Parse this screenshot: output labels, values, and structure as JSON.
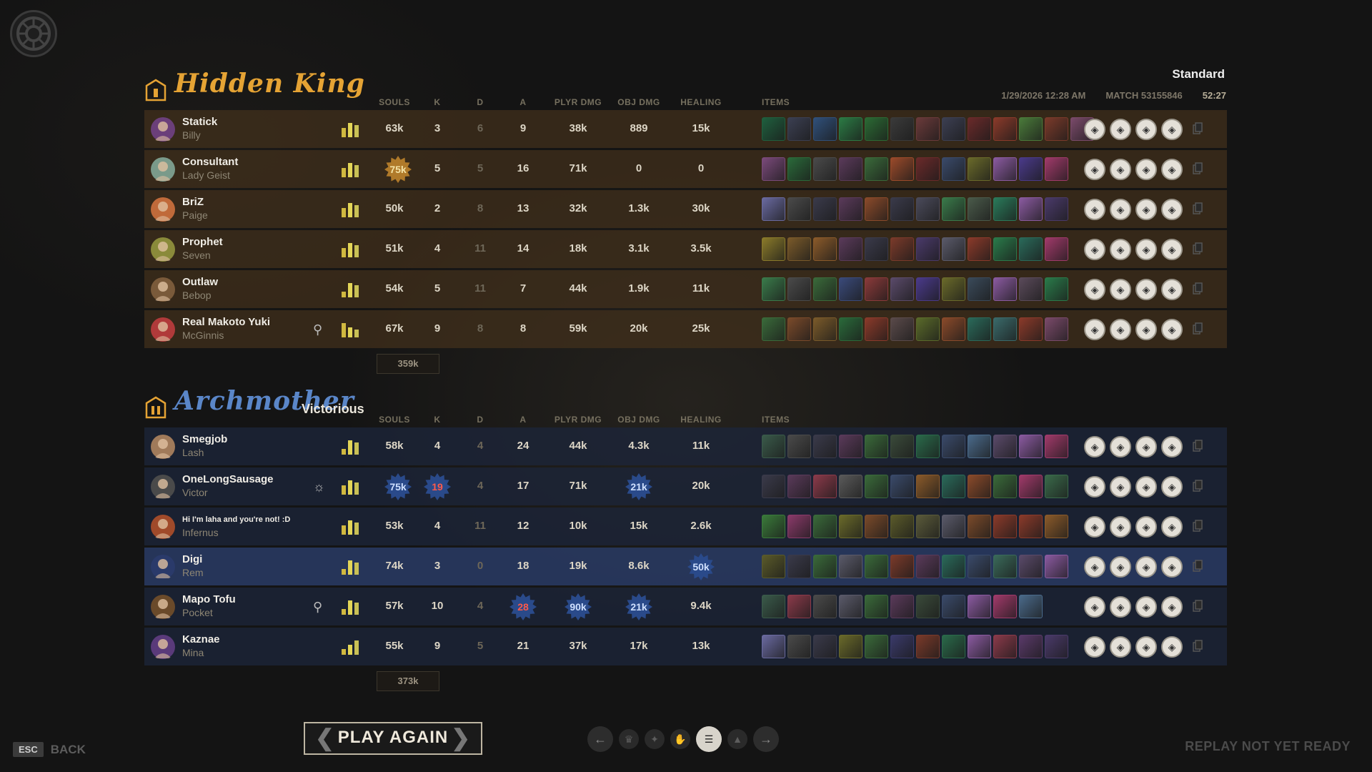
{
  "window": {
    "mode": "Standard"
  },
  "match_meta": {
    "date": "1/29/2026 12:28 AM",
    "match_id": "MATCH 53155846",
    "duration": "52:27"
  },
  "columns": {
    "souls": "SOULS",
    "k": "K",
    "d": "D",
    "a": "A",
    "player_damage": "PLYR DMG",
    "objective_damage": "OBJ DMG",
    "healing": "HEALING",
    "items": "ITEMS"
  },
  "team1": {
    "name": "Hidden King",
    "badge": "I",
    "result": "",
    "color": "#e5a334",
    "souls_total": "359k",
    "players": [
      {
        "name": "Statick",
        "hero": "Billy",
        "souls": "63k",
        "k": "3",
        "d": "6",
        "a": "9",
        "player_damage": "38k",
        "objective_damage": "889",
        "healing": "15k",
        "bars": [
          0.55,
          0.85,
          0.7
        ],
        "status_icon": "",
        "avatar_color": "#6b3f7a",
        "items": [
          "#1f5f3e",
          "#3b3f52",
          "#30507a",
          "#2b7a44",
          "#2b6a34",
          "#3a3a3a",
          "#6a3a3a",
          "#3c3f52",
          "#6a2a2a",
          "#8a3a2a",
          "#4a7a3a",
          "#7a3a2a",
          "#7a4a6a"
        ],
        "abilities": [
          "quill-icon",
          "wolf-icon",
          "shield-icon",
          "swirl-icon"
        ]
      },
      {
        "name": "Consultant",
        "hero": "Lady Geist",
        "souls": "75k",
        "souls_highlight": "gold",
        "k": "5",
        "d": "5",
        "a": "16",
        "player_damage": "71k",
        "objective_damage": "0",
        "healing": "0",
        "bars": [
          0.55,
          0.85,
          0.7
        ],
        "status_icon": "",
        "avatar_color": "#7a9a8a",
        "items": [
          "#7a4a7a",
          "#2a6a3a",
          "#4a4a4a",
          "#5a3a5a",
          "#3a6a3a",
          "#9a4a2a",
          "#6a2a2a",
          "#3a4a6a",
          "#6a6a2a",
          "#8a5aa0",
          "#4a3a8a",
          "#a03a6a"
        ],
        "abilities": [
          "bottle-icon",
          "wolf-icon",
          "leaf-icon",
          "hand-icon"
        ]
      },
      {
        "name": "BriZ",
        "hero": "Paige",
        "souls": "50k",
        "k": "2",
        "d": "8",
        "a": "13",
        "player_damage": "32k",
        "objective_damage": "1.3k",
        "healing": "30k",
        "bars": [
          0.55,
          0.85,
          0.7
        ],
        "status_icon": "",
        "avatar_color": "#c06a3a",
        "items": [
          "#6a6aa0",
          "#4a4a4a",
          "#3a3a4a",
          "#5a3a5a",
          "#8a4a2a",
          "#3a3a4a",
          "#4a4a5a",
          "#3a7a4a",
          "#4a5a4a",
          "#2a7a5a",
          "#8a5aa0",
          "#4a3a6a"
        ],
        "abilities": [
          "face-icon",
          "helm-icon",
          "tower-icon",
          "arrow-icon"
        ]
      },
      {
        "name": "Prophet",
        "hero": "Seven",
        "souls": "51k",
        "k": "4",
        "d": "11",
        "a": "14",
        "player_damage": "18k",
        "objective_damage": "3.1k",
        "healing": "3.5k",
        "bars": [
          0.55,
          0.85,
          0.7
        ],
        "status_icon": "",
        "avatar_color": "#8a8a3a",
        "items": [
          "#8a7a2a",
          "#7a5a2a",
          "#8a5a2a",
          "#5a3a5a",
          "#3a3a4a",
          "#7a3a2a",
          "#4a3a6a",
          "#5a5a6a",
          "#8a3a2a",
          "#2a7a4a",
          "#2a6a5a",
          "#a03a6a"
        ],
        "abilities": [
          "eye-icon",
          "spark-icon",
          "bolt-icon",
          "storm-icon"
        ]
      },
      {
        "name": "Outlaw",
        "hero": "Bebop",
        "souls": "54k",
        "k": "5",
        "d": "11",
        "a": "7",
        "player_damage": "44k",
        "objective_damage": "1.9k",
        "healing": "11k",
        "bars": [
          0.35,
          0.85,
          0.7
        ],
        "status_icon": "",
        "avatar_color": "#7a5a3a",
        "items": [
          "#3a7a4a",
          "#4a4a4a",
          "#3a6a3a",
          "#3a4a7a",
          "#8a3a3a",
          "#5a4a6a",
          "#4a3a8a",
          "#6a6a2a",
          "#3a4a5a",
          "#8a5aa0",
          "#5a4a5a",
          "#2a7a4a"
        ],
        "abilities": [
          "fist-icon",
          "gear-icon",
          "hook-icon",
          "bomb-icon"
        ]
      },
      {
        "name": "Real Makoto Yuki",
        "hero": "McGinnis",
        "souls": "67k",
        "k": "9",
        "d": "8",
        "a": "8",
        "player_damage": "59k",
        "objective_damage": "20k",
        "healing": "25k",
        "bars": [
          0.85,
          0.6,
          0.45
        ],
        "status_icon": "keyhole-icon",
        "avatar_color": "#b03a3a",
        "items": [
          "#3a6a3a",
          "#7a4a2a",
          "#7a5a2a",
          "#2a6a3a",
          "#8a3a2a",
          "#5a4a4a",
          "#5a6a2a",
          "#8a4a2a",
          "#2a6a5a",
          "#3a6a6a",
          "#8a3a2a",
          "#7a4a6a"
        ],
        "abilities": [
          "turret-icon",
          "wrench-icon",
          "wall-icon",
          "slash-icon"
        ]
      }
    ]
  },
  "team2": {
    "name": "Archmother",
    "badge": "II",
    "result": "Victorious",
    "color": "#5a86c8",
    "souls_total": "373k",
    "players": [
      {
        "name": "Smegjob",
        "hero": "Lash",
        "souls": "58k",
        "k": "4",
        "d": "4",
        "a": "24",
        "player_damage": "44k",
        "objective_damage": "4.3k",
        "healing": "11k",
        "bars": [
          0.35,
          0.85,
          0.7
        ],
        "status_icon": "",
        "avatar_color": "#a07a5a",
        "items": [
          "#3a5a4a",
          "#4a4a4a",
          "#3a3a4a",
          "#5a3a5a",
          "#3a6a3a",
          "#3a4a3a",
          "#2a6a4a",
          "#3a4a6a",
          "#4a6a8a",
          "#5a4a6a",
          "#8a5aa0",
          "#a03a6a"
        ],
        "abilities": [
          "whip-icon",
          "leap-icon",
          "ground-icon",
          "grab-icon"
        ]
      },
      {
        "name": "OneLongSausage",
        "hero": "Victor",
        "souls": "75k",
        "souls_highlight": "blue",
        "k": "19",
        "k_highlight": "red",
        "d": "4",
        "a": "17",
        "player_damage": "71k",
        "objective_damage": "21k",
        "objective_damage_highlight": "blue",
        "healing": "20k",
        "bars": [
          0.55,
          0.85,
          0.7
        ],
        "status_icon": "sun-icon",
        "avatar_color": "#4a4a4a",
        "items": [
          "#3a3a4a",
          "#5a3a5a",
          "#8a3a4a",
          "#5a5a5a",
          "#3a6a3a",
          "#3a4a6a",
          "#8a5a2a",
          "#2a6a5a",
          "#8a4a2a",
          "#3a6a3a",
          "#a03a6a",
          "#3a6a4a"
        ],
        "abilities": [
          "syringe-icon",
          "claw-icon",
          "pulse-icon",
          "heart-icon"
        ]
      },
      {
        "name": "Hi I'm laha and you're not! :D",
        "hero": "Infernus",
        "name_small": true,
        "souls": "53k",
        "k": "4",
        "d": "11",
        "a": "12",
        "player_damage": "10k",
        "objective_damage": "15k",
        "healing": "2.6k",
        "bars": [
          0.55,
          0.85,
          0.7
        ],
        "status_icon": "",
        "avatar_color": "#a04a2a",
        "items": [
          "#3a7a3a",
          "#8a3a6a",
          "#3a6a3a",
          "#6a6a2a",
          "#7a4a2a",
          "#5a5a2a",
          "#5a5a3a",
          "#5a5a6a",
          "#7a4a2a",
          "#8a3a2a",
          "#8a3a2a",
          "#8a5a2a"
        ],
        "abilities": [
          "flame-icon",
          "dash-icon",
          "fire-icon",
          "burst-icon"
        ]
      },
      {
        "name": "Digi",
        "hero": "Rem",
        "souls": "74k",
        "k": "3",
        "d": "0",
        "a": "18",
        "player_damage": "19k",
        "objective_damage": "8.6k",
        "healing": "50k",
        "healing_highlight": "blue",
        "bars": [
          0.35,
          0.85,
          0.7
        ],
        "status_icon": "",
        "avatar_color": "#2a3a6a",
        "highlight": true,
        "items": [
          "#5a5a2a",
          "#3a3a4a",
          "#3a6a3a",
          "#5a5a6a",
          "#3a6a3a",
          "#7a3a2a",
          "#5a3a5a",
          "#2a6a5a",
          "#3a4a6a",
          "#3a6a5a",
          "#5a4a6a",
          "#8a5aa0"
        ],
        "abilities": [
          "cloud-icon",
          "star-icon",
          "lamp-icon",
          "moon-icon"
        ]
      },
      {
        "name": "Mapo Tofu",
        "hero": "Pocket",
        "souls": "57k",
        "k": "10",
        "d": "4",
        "a": "28",
        "a_highlight": "red",
        "player_damage": "90k",
        "player_damage_highlight": "blue",
        "objective_damage": "21k",
        "objective_damage_highlight": "blue",
        "healing": "9.4k",
        "bars": [
          0.35,
          0.85,
          0.7
        ],
        "status_icon": "keyhole-icon",
        "avatar_color": "#6a4a2a",
        "items": [
          "#3a5a4a",
          "#8a3a4a",
          "#4a4a4a",
          "#5a5a6a",
          "#3a6a3a",
          "#5a3a5a",
          "#3a4a3a",
          "#3a4a6a",
          "#8a5aa0",
          "#a03a6a",
          "#4a6a8a"
        ],
        "abilities": [
          "cape-icon",
          "case-icon",
          "bird-icon",
          "barrage-icon"
        ]
      },
      {
        "name": "Kaznae",
        "hero": "Mina",
        "souls": "55k",
        "k": "9",
        "d": "5",
        "a": "21",
        "player_damage": "37k",
        "objective_damage": "17k",
        "healing": "13k",
        "bars": [
          0.35,
          0.6,
          0.85
        ],
        "status_icon": "",
        "avatar_color": "#5a3a7a",
        "items": [
          "#6a6aa0",
          "#4a4a4a",
          "#3a3a4a",
          "#6a6a2a",
          "#3a6a3a",
          "#3a3a6a",
          "#7a3a2a",
          "#2a6a4a",
          "#8a5aa0",
          "#8a3a4a",
          "#5a3a6a",
          "#4a3a6a"
        ],
        "abilities": [
          "bat-icon",
          "fang-icon",
          "target-icon",
          "nova-icon"
        ]
      }
    ]
  },
  "footer": {
    "esc_key": "ESC",
    "back_label": "BACK",
    "play_again": "PLAY AGAIN",
    "replay_status": "REPLAY NOT YET READY",
    "pager_tabs": [
      "trophy-icon",
      "lightbulb-icon",
      "hand-icon",
      "list-icon",
      "chart-icon"
    ],
    "active_tab": 3
  }
}
